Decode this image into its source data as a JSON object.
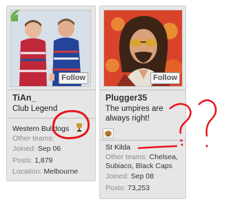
{
  "cards": [
    {
      "username": "TiAn_",
      "title": "Club Legend",
      "team": "Western Bulldogs",
      "other_teams_label": "Other teams:",
      "joined_label": "Joined:",
      "joined_value": "Sep 06",
      "posts_label": "Posts:",
      "posts_value": "1,879",
      "location_label": "Location:",
      "location_value": "Melbourne",
      "follow_label": "Follow",
      "badge_icon": "trophy-icon"
    },
    {
      "username": "Plugger35",
      "title_line1": "The umpires are",
      "title_line2": "always right!",
      "team": "St Kilda",
      "other_teams_label": "Other teams:",
      "other_teams_line1": "Chelsea,",
      "other_teams_line2": "Subiaco, Black Caps",
      "joined_label": "Joined:",
      "joined_value": "Sep 08",
      "posts_label": "Posts:",
      "posts_value": "73,253",
      "follow_label": "Follow",
      "badge_icon": "dog-icon"
    }
  ],
  "colors": {
    "card_bg": "#e6e6e6",
    "label_gray": "#8b8b8b",
    "annotation_red": "#e8141d",
    "online_green": "#69b24f"
  }
}
